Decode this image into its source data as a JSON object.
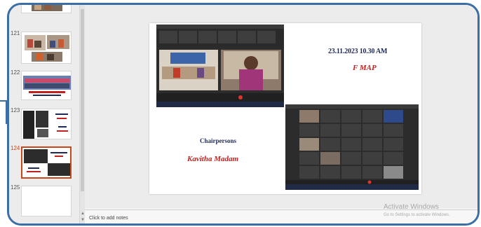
{
  "thumbnails": [
    {
      "num": "",
      "label": ""
    },
    {
      "num": "121",
      "label": ""
    },
    {
      "num": "122",
      "label": ""
    },
    {
      "num": "123",
      "label": ""
    },
    {
      "num": "124",
      "label": "",
      "selected": true
    },
    {
      "num": "125",
      "label": ""
    }
  ],
  "slide": {
    "date_time": "23.11.2023   10.30 AM",
    "session": "F MAP",
    "chairpersons_label": "Chairpersons",
    "chairperson_name": "Kavitha Madam"
  },
  "notes": {
    "placeholder": "Click to add notes"
  },
  "watermark": {
    "line1": "Activate Windows",
    "line2": "Go to Settings to activate Windows."
  },
  "colors": {
    "frame": "#3b6ea5",
    "selected_thumb": "#c5471b",
    "title_navy": "#1e2a55",
    "accent_red": "#c0211f"
  }
}
